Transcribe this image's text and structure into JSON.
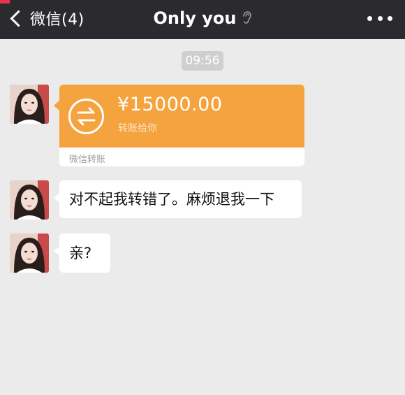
{
  "header": {
    "back_label": "微信(4)",
    "title": "Only you",
    "title_icon": "ear-icon",
    "more_icon": "more-icon",
    "background": "#2b2b2f"
  },
  "chat": {
    "timestamp": "09:56",
    "messages": [
      {
        "type": "transfer",
        "sender": "contact",
        "amount": "¥15000.00",
        "note": "转账给你",
        "footer": "微信转账",
        "color": "#f5a33e"
      },
      {
        "type": "text",
        "sender": "contact",
        "text": "对不起我转错了。麻烦退我一下"
      },
      {
        "type": "text",
        "sender": "contact",
        "text": "亲?"
      }
    ]
  },
  "colors": {
    "chat_background": "#ebebeb",
    "transfer_orange": "#f5a33e",
    "bubble": "#ffffff"
  }
}
